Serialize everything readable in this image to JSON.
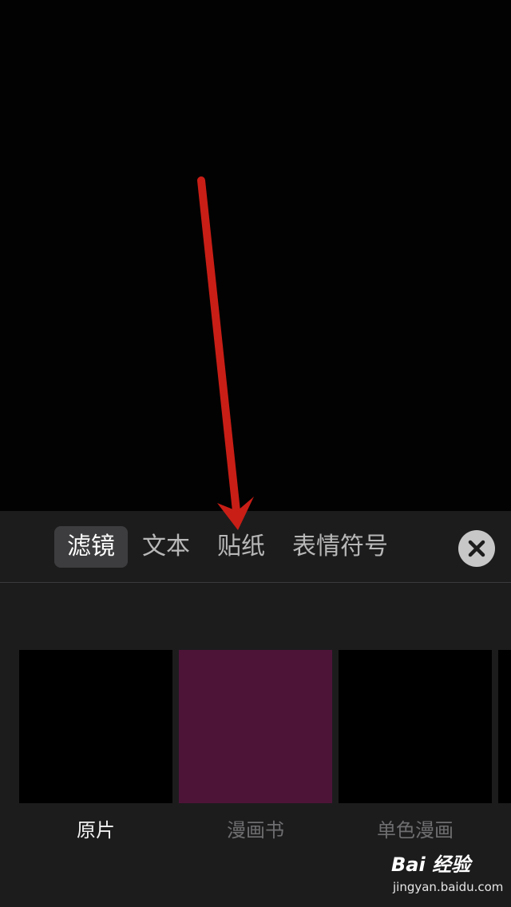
{
  "tabs": [
    {
      "label": "滤镜",
      "active": true
    },
    {
      "label": "文本",
      "active": false
    },
    {
      "label": "贴纸",
      "active": false
    },
    {
      "label": "表情符号",
      "active": false
    }
  ],
  "close_icon": "close-icon",
  "filters": [
    {
      "label": "原片",
      "color": "#000000",
      "selected": true
    },
    {
      "label": "漫画书",
      "color": "#4e1438",
      "selected": false
    },
    {
      "label": "单色漫画",
      "color": "#000000",
      "selected": false
    }
  ],
  "annotation": {
    "color": "#c81e16"
  },
  "watermark": {
    "logo": "Bai 经验",
    "url": "jingyan.baidu.com"
  }
}
